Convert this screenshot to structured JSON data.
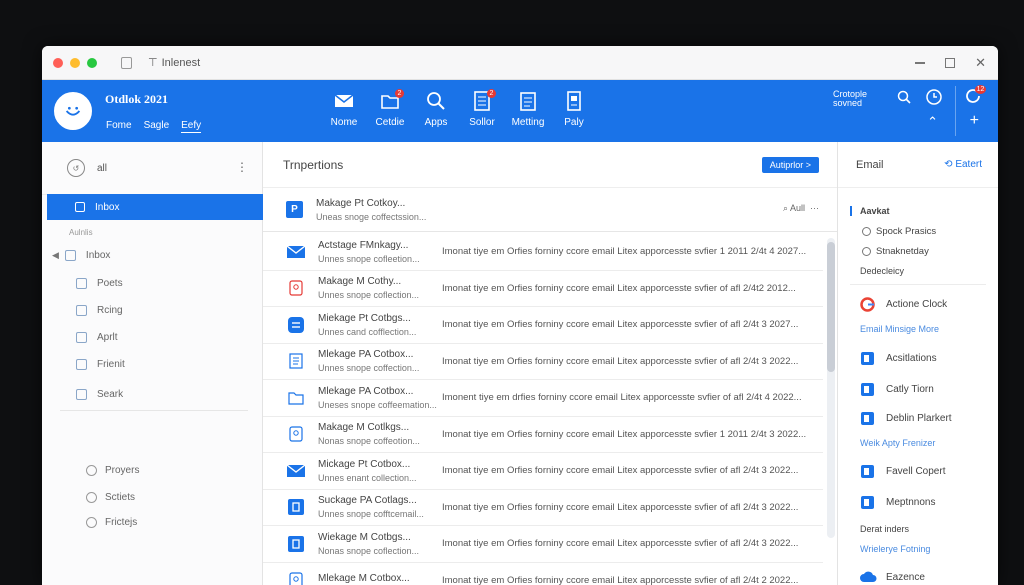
{
  "window": {
    "title": "Inlenest"
  },
  "app": {
    "title": "Otdlok 2021",
    "links": [
      "Fome",
      "Sagle",
      "Eefy"
    ]
  },
  "toolbar": [
    {
      "label": "Nome",
      "icon": "mail-icon",
      "badge": ""
    },
    {
      "label": "Cetdie",
      "icon": "folder-icon",
      "badge": "2"
    },
    {
      "label": "Apps",
      "icon": "search-icon",
      "badge": ""
    },
    {
      "label": "Sollor",
      "icon": "document-icon",
      "badge": "2"
    },
    {
      "label": "Metting",
      "icon": "clipboard-icon",
      "badge": ""
    },
    {
      "label": "Paly",
      "icon": "tablet-icon",
      "badge": ""
    }
  ],
  "ribbon_right": {
    "line1": "Crotople",
    "line2": "sovned",
    "sync_badge": "12"
  },
  "sidebar": {
    "top_label": "all",
    "active_item": "Inbox",
    "section_label": "Aulnlis",
    "items": [
      "Inbox",
      "Poets",
      "Rcing",
      "Aprlt",
      "Frienit",
      "Seark"
    ],
    "bottom_items": [
      "Proyers",
      "Sctiets",
      "Frictejs"
    ]
  },
  "list": {
    "header": "Trnpertions",
    "button": "Autiprlor >",
    "pinned": {
      "icon_letter": "P",
      "sender": "Makage Pt Cotkoy...",
      "preview": "Uneas snoge coffectssion...",
      "action": "Aull"
    },
    "rows": [
      {
        "icon": "envelope-icon",
        "color": "#1a73e8",
        "sender": "Actstage FMnkagy...",
        "sub": "Unnes snope cofleetion...",
        "preview": "Imonat tiye em Orfies forniny ccore email Litex apporcesste svfier 1 2011 2/4t 4 2027..."
      },
      {
        "icon": "contact-card-icon",
        "color": "#e53935",
        "sender": "Makage M Cothy...",
        "sub": "Unnes snope coflection...",
        "preview": "Imonat tiye em Orfies forniny ccore email Litex apporcesste svfier of afl 2/4t2 2012..."
      },
      {
        "icon": "chat-icon",
        "color": "#1a73e8",
        "sender": "Miekage Pt Cotbgs...",
        "sub": "Unnes cand cofflection...",
        "preview": "Imonat tiye em Orfies forniny ccore email Litex apporcesste svfier of afl 2/4t 3 2027..."
      },
      {
        "icon": "document-icon",
        "color": "#1a73e8",
        "sender": "Mlekage PA Cotbox...",
        "sub": "Unnes snope coffection...",
        "preview": "Imonat tiye em Orfies forniny ccore email Litex apporcesste svfier of afl 2/4t 3 2022..."
      },
      {
        "icon": "folder-icon",
        "color": "#1a73e8",
        "sender": "Mlekage PA Cotbox...",
        "sub": "Uneses snope coffeemation...",
        "preview": "Imonent tiye em drfies forniny ccore email Litex apporcesste svfier of afl 2/4t 4 2022..."
      },
      {
        "icon": "contact-card-icon",
        "color": "#1a73e8",
        "sender": "Makage M Cotlkgs...",
        "sub": "Nonas snope coffeotion...",
        "preview": "Imonat tiye em Orfies forniny ccore email Litex apporcesste svfier 1 2011 2/4t 3 2022..."
      },
      {
        "icon": "envelope-icon",
        "color": "#1a73e8",
        "sender": "Mickage Pt Cotbox...",
        "sub": "Unnes enant collection...",
        "preview": "Imonat tiye em Orfies forniny ccore email Litex apporcesste svfier of afl 2/4t 3 2022..."
      },
      {
        "icon": "app-tile-icon",
        "color": "#1a73e8",
        "sender": "Suckage PA Cotlags...",
        "sub": "Unnes snope cofftcemail...",
        "preview": "Imonat tiye em Orfies forniny ccore email Litex apporcesste svfier of afl 2/4t 3 2022..."
      },
      {
        "icon": "app-tile-icon",
        "color": "#1a73e8",
        "sender": "Wiekage M Cotbgs...",
        "sub": "Nonas snope coflection...",
        "preview": "Imonat tiye em Orfies forniny ccore email Litex apporcesste svfier of afl 2/4t 3 2022..."
      },
      {
        "icon": "contact-card-icon",
        "color": "#1a73e8",
        "sender": "Mlekage M Cotbox...",
        "sub": "",
        "preview": "Imonat tiye em Orfies forniny ccore email Litex apporcesste svfier of afl 2/4t 2 2022..."
      }
    ]
  },
  "right_panel": {
    "header": "Email",
    "extra": "Eatert",
    "agenda_title": "Aavkat",
    "agenda_items": [
      "Spock Prasics",
      "Stnaknetday"
    ],
    "agenda_footer": "Dedecleicy",
    "items": [
      {
        "label": "Actione Clock",
        "icon": "google-icon",
        "color": "#ea4335"
      },
      {
        "sub": "Email Minsige More"
      },
      {
        "label": "Acsitlations",
        "icon": "people-icon",
        "color": "#1a73e8"
      },
      {
        "label": "Catly Tiorn",
        "icon": "bookmark-icon",
        "color": "#1a73e8"
      },
      {
        "label": "Deblin Plarkert",
        "icon": "contact-icon",
        "color": "#1a73e8"
      },
      {
        "sub": "Weik Apty Frenizer"
      },
      {
        "label": "Favell Copert",
        "icon": "tile-icon",
        "color": "#1a73e8"
      },
      {
        "label": "Meptnnons",
        "icon": "tile-icon",
        "color": "#1a73e8"
      },
      {
        "heading": "Derat inders"
      },
      {
        "sub": "Wrielerye Fotning"
      },
      {
        "label": "Eazence",
        "icon": "cloud-icon",
        "color": "#1a73e8"
      }
    ]
  }
}
